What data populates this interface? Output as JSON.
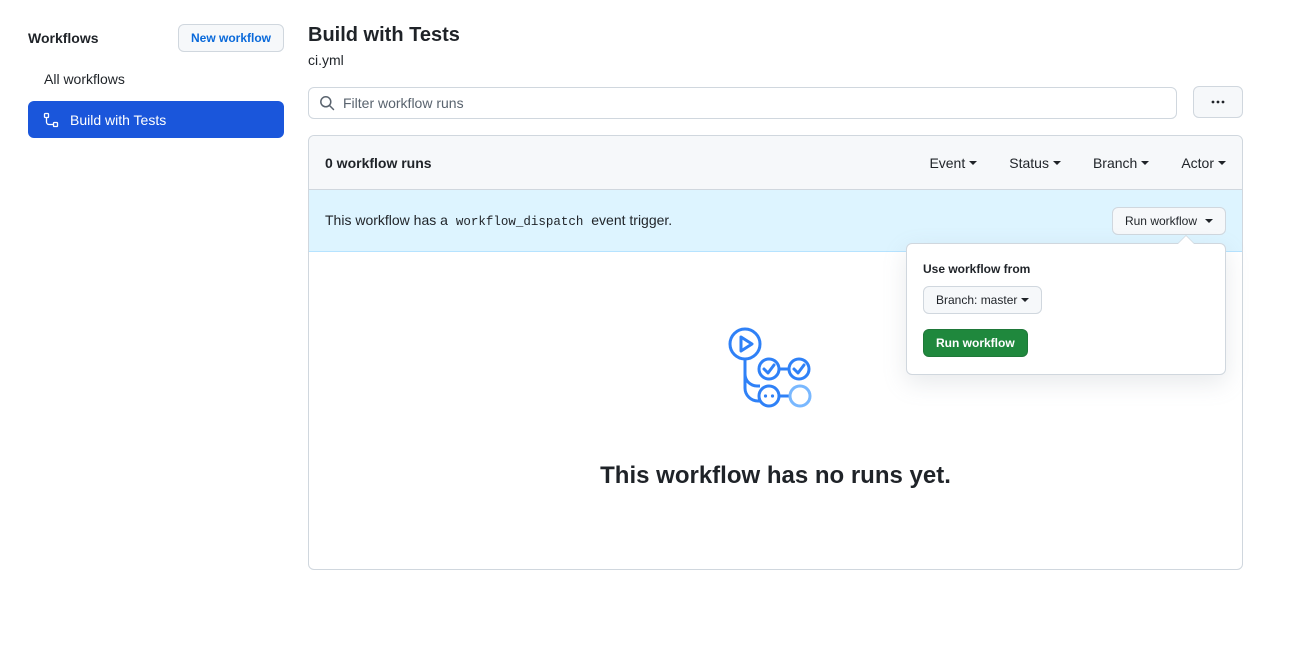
{
  "sidebar": {
    "title": "Workflows",
    "new_workflow_label": "New workflow",
    "items": [
      {
        "label": "All workflows",
        "active": false
      },
      {
        "label": "Build with Tests",
        "active": true,
        "icon": "workflow-icon"
      }
    ]
  },
  "header": {
    "title": "Build with Tests",
    "file": "ci.yml"
  },
  "search": {
    "placeholder": "Filter workflow runs",
    "value": "",
    "icon": "search-icon"
  },
  "more_menu": {
    "icon": "kebab-horizontal-icon"
  },
  "runs": {
    "count_label": "0 workflow runs",
    "filters": [
      "Event",
      "Status",
      "Branch",
      "Actor"
    ]
  },
  "dispatch": {
    "text_before": "This workflow has a",
    "code": "workflow_dispatch",
    "text_after": "event trigger.",
    "button_label": "Run workflow"
  },
  "popover": {
    "label": "Use workflow from",
    "branch_label": "Branch: master",
    "run_label": "Run workflow"
  },
  "empty_state": {
    "icon": "actions-workflow-icon",
    "title": "This workflow has no runs yet."
  },
  "colors": {
    "accent": "#1a56db",
    "link": "#0969da",
    "success": "#1f883d",
    "info_bg": "#ddf4ff"
  }
}
